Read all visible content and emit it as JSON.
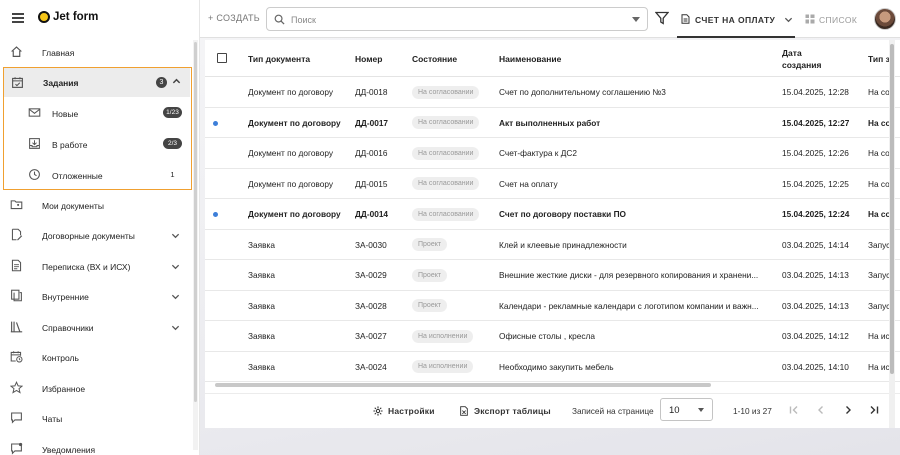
{
  "brand": {
    "name": "Jet form"
  },
  "sidebar": {
    "items": [
      {
        "label": "Главная",
        "icon": "home-icon"
      },
      {
        "label": "Мои документы",
        "icon": "folder-user-icon"
      },
      {
        "label": "Договорные документы",
        "icon": "document-edit-icon"
      },
      {
        "label": "Переписка (ВХ и ИСХ)",
        "icon": "document-text-icon"
      },
      {
        "label": "Внутренние",
        "icon": "documents-icon"
      },
      {
        "label": "Справочники",
        "icon": "books-icon"
      },
      {
        "label": "Контроль",
        "icon": "calendar-clock-icon"
      },
      {
        "label": "Избранное",
        "icon": "star-icon"
      },
      {
        "label": "Чаты",
        "icon": "chat-icon"
      },
      {
        "label": "Уведомления",
        "icon": "bell-icon"
      }
    ],
    "tasks": {
      "label": "Задания",
      "count": "3",
      "sub": [
        {
          "label": "Новые",
          "count": "1/23"
        },
        {
          "label": "В работе",
          "count": "2/3"
        },
        {
          "label": "Отложенные",
          "count": "1"
        }
      ]
    }
  },
  "topbar": {
    "create_label": "+ СОЗДАТЬ",
    "search_placeholder": "Поиск",
    "view_tab_label": "СЧЕТ НА ОПЛАТУ",
    "list_label": "СПИСОК"
  },
  "table": {
    "columns": [
      "Тип документа",
      "Номер",
      "Состояние",
      "Наименование",
      "Дата создания",
      "Тип за"
    ],
    "rows": [
      {
        "unread": false,
        "type": "Документ по договору",
        "number": "ДД-0018",
        "status": "На согласовании",
        "name": "Счет по дополнительному соглашению №3",
        "date": "15.04.2025, 12:28",
        "extra": "На со"
      },
      {
        "unread": true,
        "type": "Документ по договору",
        "number": "ДД-0017",
        "status": "На согласовании",
        "name": "Акт выполненных работ",
        "date": "15.04.2025, 12:27",
        "extra": "На со"
      },
      {
        "unread": false,
        "type": "Документ по договору",
        "number": "ДД-0016",
        "status": "На согласовании",
        "name": "Счет-фактура к ДС2",
        "date": "15.04.2025, 12:26",
        "extra": "На со"
      },
      {
        "unread": false,
        "type": "Документ по договору",
        "number": "ДД-0015",
        "status": "На согласовании",
        "name": "Счет на оплату",
        "date": "15.04.2025, 12:25",
        "extra": "На со"
      },
      {
        "unread": true,
        "type": "Документ по договору",
        "number": "ДД-0014",
        "status": "На согласовании",
        "name": "Счет по договору поставки ПО",
        "date": "15.04.2025, 12:24",
        "extra": "На со"
      },
      {
        "unread": false,
        "type": "Заявка",
        "number": "ЗА-0030",
        "status": "Проект",
        "name": "Клей и клеевые принадлежности",
        "date": "03.04.2025, 14:14",
        "extra": "Запус"
      },
      {
        "unread": false,
        "type": "Заявка",
        "number": "ЗА-0029",
        "status": "Проект",
        "name": "Внешние жесткие диски - для резервного копирования и хранени...",
        "date": "03.04.2025, 14:13",
        "extra": "Запус"
      },
      {
        "unread": false,
        "type": "Заявка",
        "number": "ЗА-0028",
        "status": "Проект",
        "name": "Календари - рекламные календари с логотипом компании и важн...",
        "date": "03.04.2025, 14:13",
        "extra": "Запус"
      },
      {
        "unread": false,
        "type": "Заявка",
        "number": "ЗА-0027",
        "status": "На исполнении",
        "name": "Офисные столы , кресла",
        "date": "03.04.2025, 14:12",
        "extra": "На ис"
      },
      {
        "unread": false,
        "type": "Заявка",
        "number": "ЗА-0024",
        "status": "На исполнении",
        "name": "Необходимо закупить мебель",
        "date": "03.04.2025, 14:10",
        "extra": "На ис"
      }
    ]
  },
  "footer": {
    "settings_label": "Настройки",
    "export_label": "Экспорт таблицы",
    "rows_per_page_label": "Записей на странице",
    "rows_per_page_value": "10",
    "range_label": "1-10 из 27"
  },
  "colors": {
    "accent_outline": "#f0a030",
    "unread_dot": "#3d7fd9",
    "logo_yellow": "#f5c518"
  }
}
